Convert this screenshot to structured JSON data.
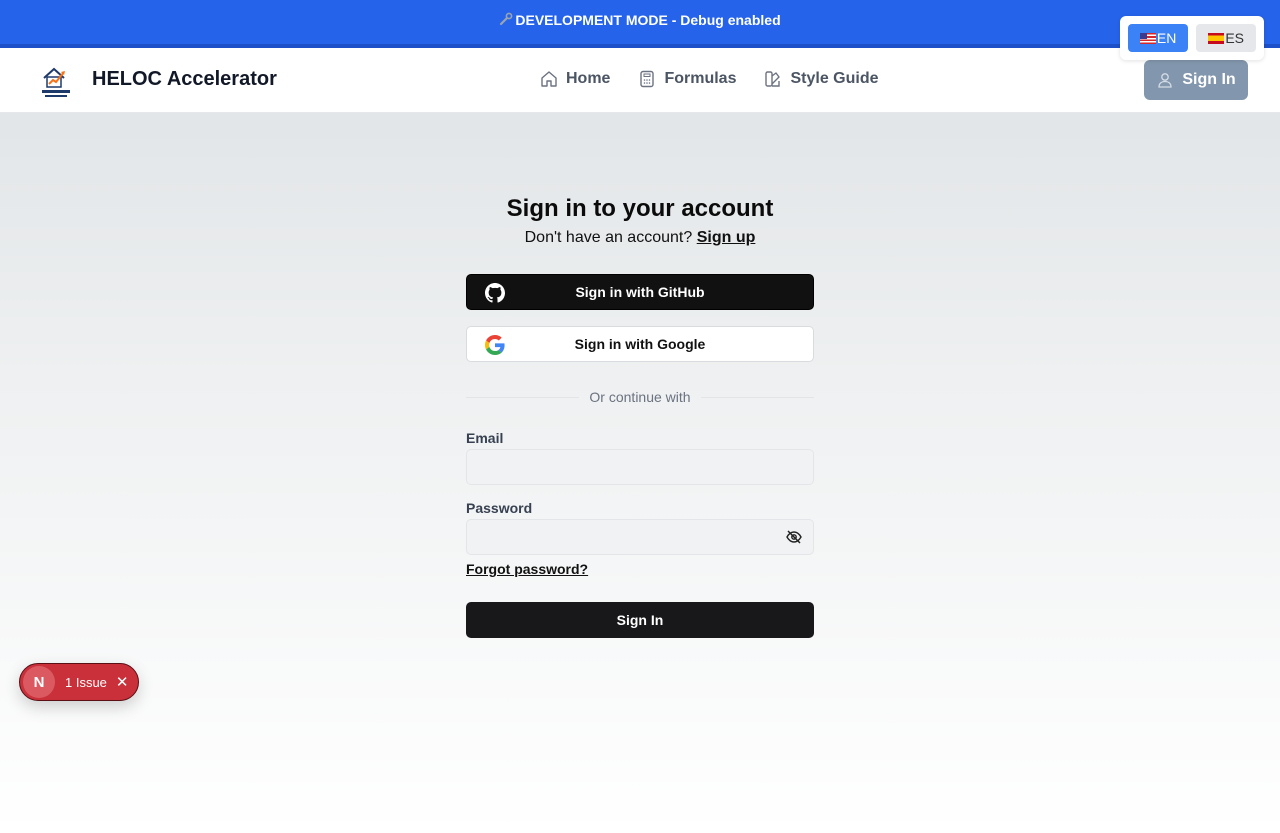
{
  "banner": {
    "icon": "wrench-icon",
    "text": "DEVELOPMENT MODE - Debug enabled",
    "color": "#2563eb"
  },
  "lang": {
    "en_label": "EN",
    "es_label": "ES",
    "active": "EN"
  },
  "header": {
    "brand": "HELOC Accelerator",
    "logo_text": "HELOC",
    "nav": [
      {
        "label": "Home",
        "icon": "home-icon"
      },
      {
        "label": "Formulas",
        "icon": "calculator-icon"
      },
      {
        "label": "Style Guide",
        "icon": "palette-icon"
      }
    ],
    "signin_label": "Sign In"
  },
  "form": {
    "title": "Sign in to your account",
    "subtitle": "Don't have an account?",
    "signup_link": "Sign up",
    "github_label": "Sign in with GitHub",
    "google_label": "Sign in with Google",
    "divider": "Or continue with",
    "email_label": "Email",
    "email_value": "",
    "password_label": "Password",
    "password_value": "",
    "forgot": "Forgot password?",
    "submit": "Sign In"
  },
  "issue": {
    "logo_letter": "N",
    "label": "1 Issue",
    "color": "#c9303a"
  }
}
